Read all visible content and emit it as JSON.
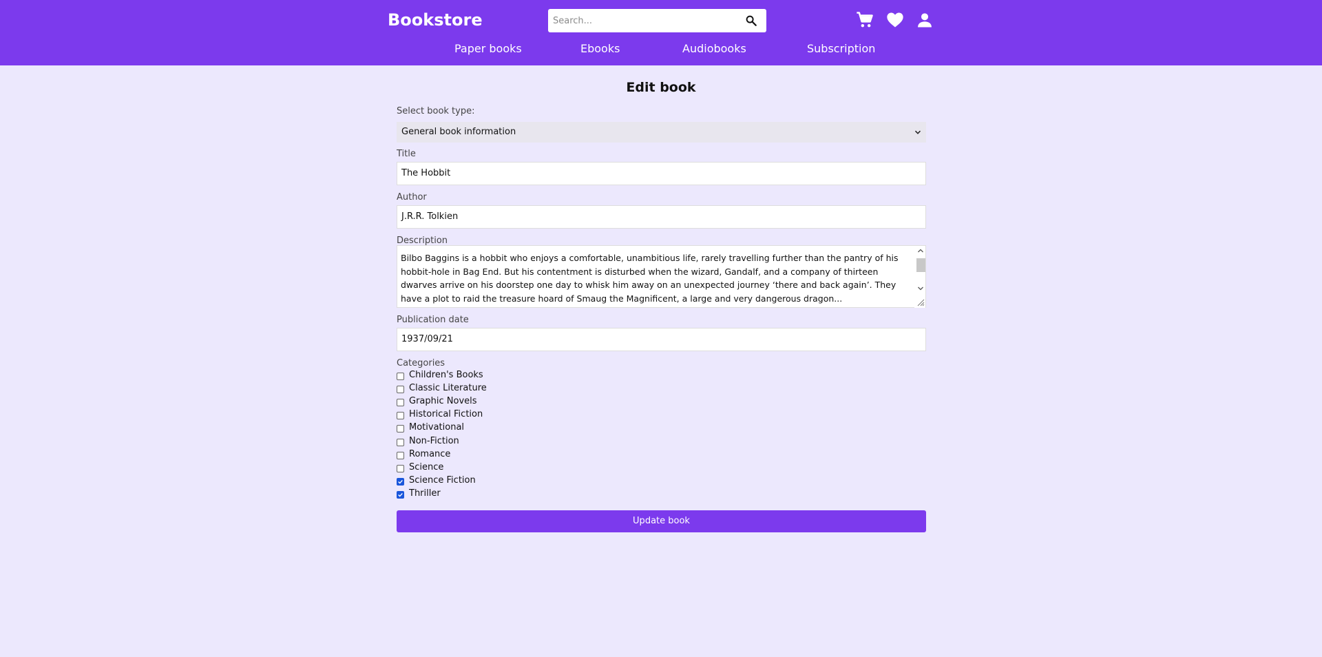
{
  "header": {
    "logo": "Bookstore",
    "search_placeholder": "Search...",
    "icons": [
      "search-icon",
      "cart-icon",
      "heart-icon",
      "user-icon"
    ],
    "nav": [
      "Paper books",
      "Ebooks",
      "Audiobooks",
      "Subscription"
    ]
  },
  "form": {
    "title": "Edit book",
    "book_type_label": "Select book type:",
    "book_type_value": "General book information",
    "title_label": "Title",
    "title_value": "The Hobbit",
    "author_label": "Author",
    "author_value": "J.R.R. Tolkien",
    "description_label": "Description",
    "description_value": "Bilbo Baggins is a hobbit who enjoys a comfortable, unambitious life, rarely travelling further than the pantry of his hobbit-hole in Bag End. But his contentment is disturbed when the wizard, Gandalf, and a company of thirteen dwarves arrive on his doorstep one day to whisk him away on an unexpected journey ‘there and back again’. They have a plot to raid the treasure hoard of Smaug the Magnificent, a large and very dangerous dragon...",
    "pubdate_label": "Publication date",
    "pubdate_value": "1937/09/21",
    "categories_label": "Categories",
    "categories": [
      {
        "label": "Children's Books",
        "checked": false
      },
      {
        "label": "Classic Literature",
        "checked": false
      },
      {
        "label": "Graphic Novels",
        "checked": false
      },
      {
        "label": "Historical Fiction",
        "checked": false
      },
      {
        "label": "Motivational",
        "checked": false
      },
      {
        "label": "Non-Fiction",
        "checked": false
      },
      {
        "label": "Romance",
        "checked": false
      },
      {
        "label": "Science",
        "checked": false
      },
      {
        "label": "Science Fiction",
        "checked": true
      },
      {
        "label": "Thriller",
        "checked": true
      }
    ],
    "submit_label": "Update book"
  },
  "colors": {
    "accent": "#7c3aed",
    "background": "#ece8fd",
    "checkbox_checked": "#1a56db"
  }
}
